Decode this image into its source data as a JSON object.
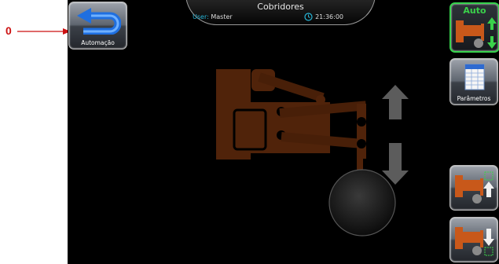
{
  "callout": {
    "number": "0"
  },
  "header": {
    "title": "Cobridores",
    "user_label": "User:",
    "user_name": "Master",
    "time": "21:36:00"
  },
  "buttons": {
    "back_label": "Automação",
    "auto_label": "Auto",
    "params_label": "Parâmetros"
  },
  "colors": {
    "accent_green": "#37d24d",
    "machine_orange": "#c8581a",
    "info_blue": "#27b6d8",
    "callout_red": "#cc1111"
  },
  "icons": {
    "back": "back-arrow-icon",
    "clock": "clock-icon",
    "params": "document-grid-icon",
    "raise": "arm-up-icon",
    "lower": "arm-down-icon"
  }
}
